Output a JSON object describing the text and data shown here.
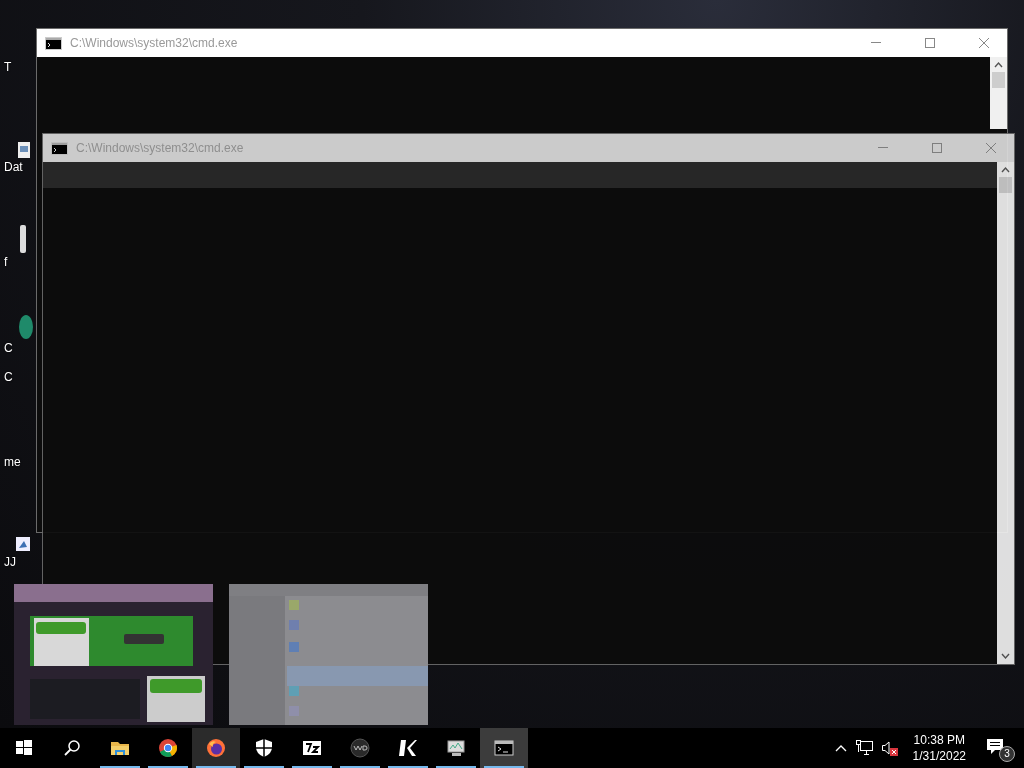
{
  "desktop_icons": [
    {
      "label": "T",
      "kind": "none"
    },
    {
      "label": "Dat",
      "kind": "file"
    },
    {
      "label": "f",
      "kind": "bar"
    },
    {
      "label": "C",
      "kind": "leaf"
    },
    {
      "label": "C",
      "kind": "none"
    },
    {
      "label": "me",
      "kind": "none"
    },
    {
      "label": "JJ",
      "kind": "shortcut"
    }
  ],
  "windows": [
    {
      "title": "C:\\Windows\\system32\\cmd.exe",
      "active": true
    },
    {
      "title": "C:\\Windows\\system32\\cmd.exe",
      "active": false
    }
  ],
  "taskbar": {
    "apps": [
      {
        "kind": "start",
        "running": false,
        "selected": false
      },
      {
        "kind": "search",
        "running": false,
        "selected": false
      },
      {
        "kind": "folder",
        "running": true,
        "selected": false
      },
      {
        "kind": "chrome",
        "running": true,
        "selected": false
      },
      {
        "kind": "firefox",
        "running": true,
        "selected": true
      },
      {
        "kind": "shield",
        "running": true,
        "selected": false
      },
      {
        "kind": "sevenzip",
        "running": true,
        "selected": false
      },
      {
        "kind": "disc",
        "running": true,
        "selected": false
      },
      {
        "kind": "k",
        "running": true,
        "selected": false
      },
      {
        "kind": "monitor",
        "running": true,
        "selected": false
      },
      {
        "kind": "cmd",
        "running": true,
        "selected": true
      }
    ],
    "clock": {
      "time": "10:38 PM",
      "date": "1/31/2022"
    },
    "notifications": {
      "count": "3"
    }
  }
}
